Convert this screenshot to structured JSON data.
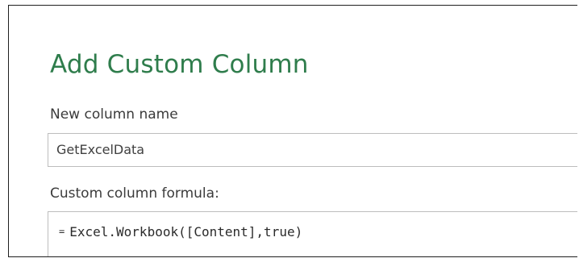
{
  "dialog": {
    "title": "Add Custom Column",
    "new_column_name_label": "New column name",
    "new_column_name_value": "GetExcelData",
    "formula_label": "Custom column formula:",
    "formula_prefix": "=",
    "formula_value": "Excel.Workbook([Content],true)"
  },
  "colors": {
    "title": "#2f7d4c",
    "border": "#bdbdbd"
  }
}
